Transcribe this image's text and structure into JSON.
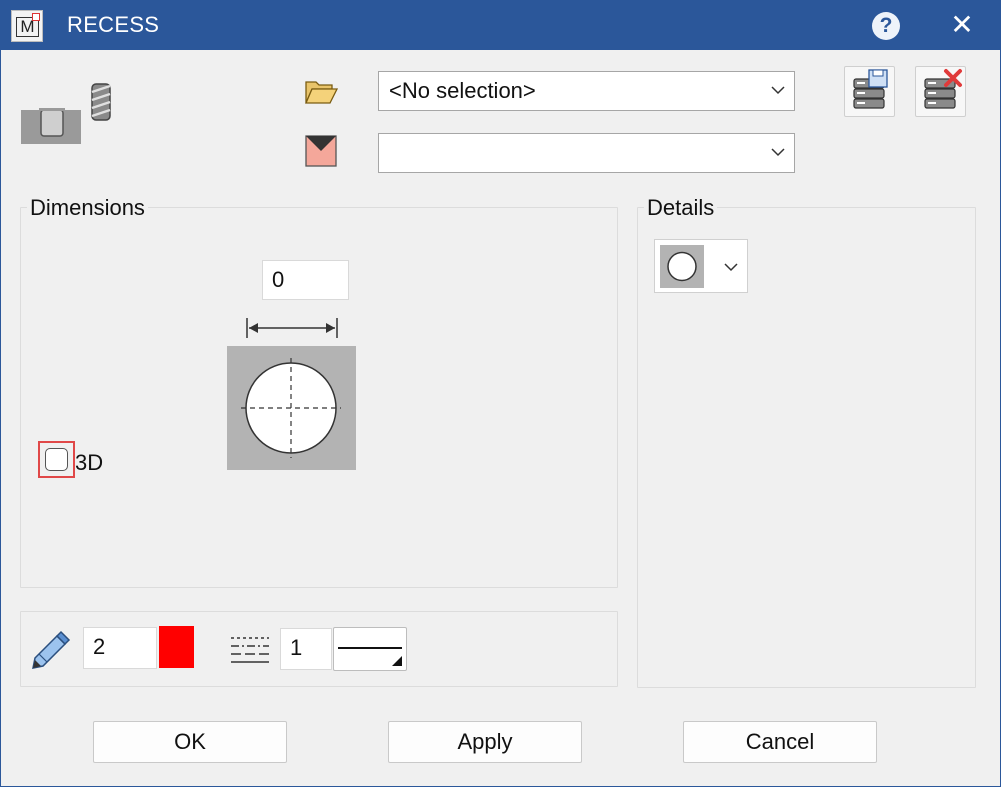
{
  "window": {
    "title": "RECESS",
    "app_icon_letter": "M",
    "help_label": "?",
    "close_label": "✕"
  },
  "top": {
    "selection_combo": {
      "value": "<No selection>"
    },
    "second_combo": {
      "value": ""
    },
    "icons": {
      "tool": "recess-tool-icon",
      "folder": "folder-open-icon",
      "material": "material-icon",
      "save_db": "database-save-icon",
      "delete_db": "database-delete-icon"
    }
  },
  "dimensions": {
    "label": "Dimensions",
    "width_value": "0",
    "threeD_label": "3D",
    "threeD_checked": false
  },
  "details": {
    "label": "Details",
    "shape_icon": "circle-icon"
  },
  "style": {
    "pen_value": "2",
    "pen_color": "#ff0000",
    "line_value": "1"
  },
  "buttons": {
    "ok": "OK",
    "apply": "Apply",
    "cancel": "Cancel"
  }
}
